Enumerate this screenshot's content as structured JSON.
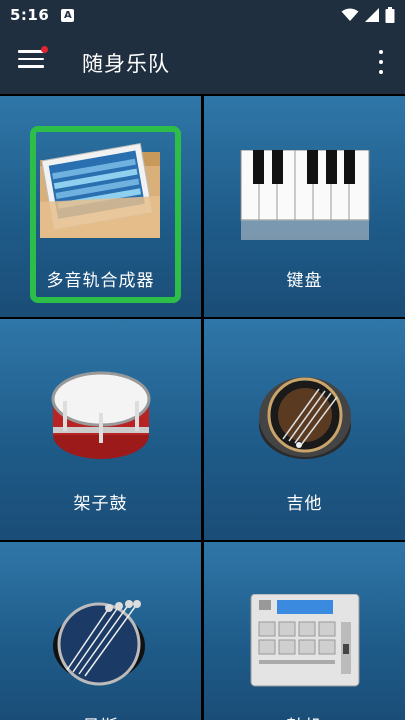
{
  "status_bar": {
    "time": "5:16",
    "notification_letter": "A"
  },
  "app_bar": {
    "title": "随身乐队"
  },
  "tiles": [
    {
      "label": "多音轨合成器",
      "selected": true,
      "icon": "multitrack-folder-icon"
    },
    {
      "label": "键盘",
      "selected": false,
      "icon": "piano-keys-icon"
    },
    {
      "label": "架子鼓",
      "selected": false,
      "icon": "drum-icon"
    },
    {
      "label": "吉他",
      "selected": false,
      "icon": "guitar-icon"
    },
    {
      "label": "贝斯",
      "selected": false,
      "icon": "bass-icon"
    },
    {
      "label": "鼓机",
      "selected": false,
      "icon": "drum-machine-icon"
    }
  ],
  "colors": {
    "app_bar": "#1f2f40",
    "tile": "#24669a",
    "selection": "#2dbe4a",
    "badge": "#e5242d"
  }
}
